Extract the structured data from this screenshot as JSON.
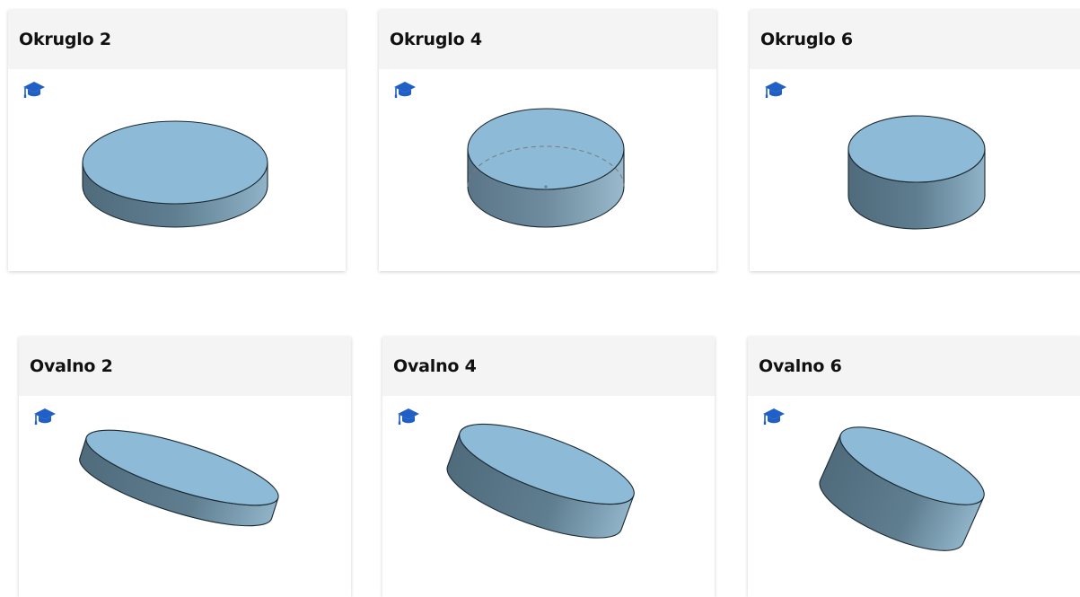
{
  "colors": {
    "header_bg": "#f4f4f4",
    "icon_blue": "#1f5fc6",
    "top_face": "#8dbad6",
    "side_dark": "#4f6b7c",
    "side_light": "#90b3c8"
  },
  "icon_name": "graduation-cap-icon",
  "cards": [
    {
      "title": "Okruglo 2"
    },
    {
      "title": "Okruglo 4"
    },
    {
      "title": "Okruglo 6"
    },
    {
      "title": "Ovalno 2"
    },
    {
      "title": "Ovalno 4"
    },
    {
      "title": "Ovalno 6"
    }
  ]
}
